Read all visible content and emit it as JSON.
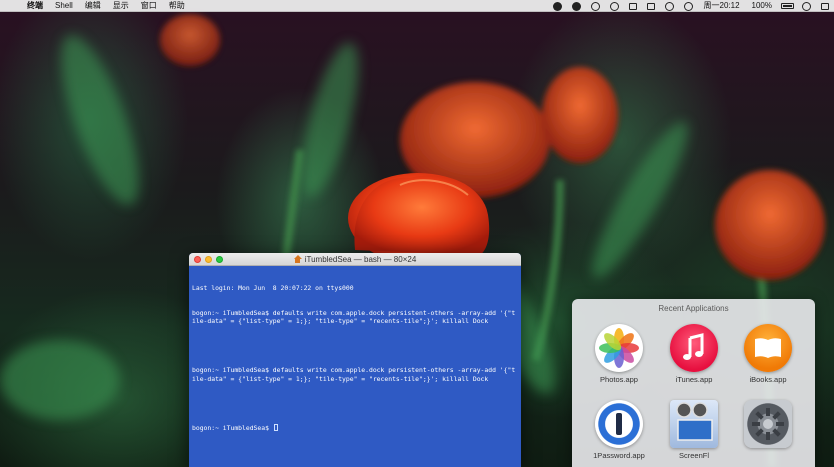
{
  "menubar": {
    "apple_glyph": "",
    "items": [
      "终端",
      "Shell",
      "编辑",
      "显示",
      "窗口",
      "帮助"
    ],
    "clock": "周一20:12",
    "battery": "100%"
  },
  "terminal": {
    "title": "iTumbledSea — bash — 80×24",
    "lines": [
      "Last login: Mon Jun  8 20:07:22 on ttys000",
      "bogon:~ iTumbledSea$ defaults write com.apple.dock persistent-others -array-add '{\"tile-data\" = {\"list-type\" = 1;}; \"tile-type\" = \"recents-tile\";}'; killall Dock",
      "",
      "bogon:~ iTumbledSea$ defaults write com.apple.dock persistent-others -array-add '{\"tile-data\" = {\"list-type\" = 1;}; \"tile-type\" = \"recents-tile\";}'; killall Dock",
      "",
      "bogon:~ iTumbledSea$ "
    ]
  },
  "recent_apps": {
    "title": "Recent Applications",
    "apps": [
      {
        "label": "Photos.app",
        "icon": "photos-icon"
      },
      {
        "label": "iTunes.app",
        "icon": "itunes-icon"
      },
      {
        "label": "iBooks.app",
        "icon": "ibooks-icon"
      },
      {
        "label": "1Password.app",
        "icon": "1password-icon"
      },
      {
        "label": "ScreenFl",
        "icon": "screenflick-icon"
      },
      {
        "label": "",
        "icon": "system-preferences-icon"
      }
    ]
  }
}
